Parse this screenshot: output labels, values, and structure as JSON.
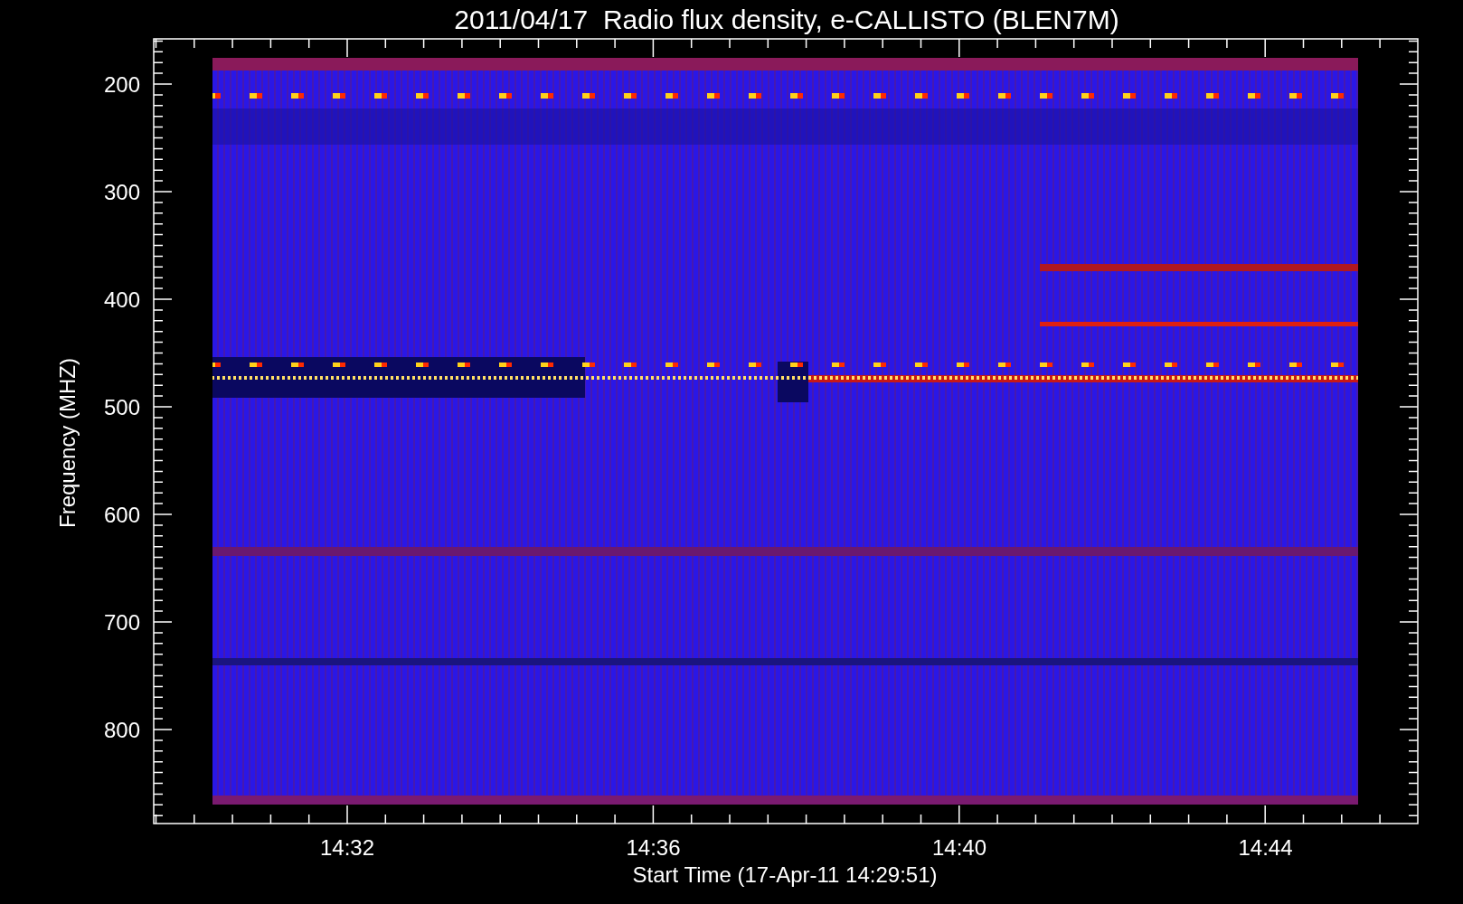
{
  "title": "2011/04/17  Radio flux density, e-CALLISTO (BLEN7M)",
  "y_axis": {
    "label": "Frequency (MHZ)",
    "tick_labels": [
      "200",
      "300",
      "400",
      "500",
      "600",
      "700",
      "800"
    ]
  },
  "x_axis": {
    "label": "Start Time (17-Apr-11 14:29:51)",
    "tick_labels": [
      "14:32",
      "14:36",
      "14:40",
      "14:44"
    ]
  }
}
